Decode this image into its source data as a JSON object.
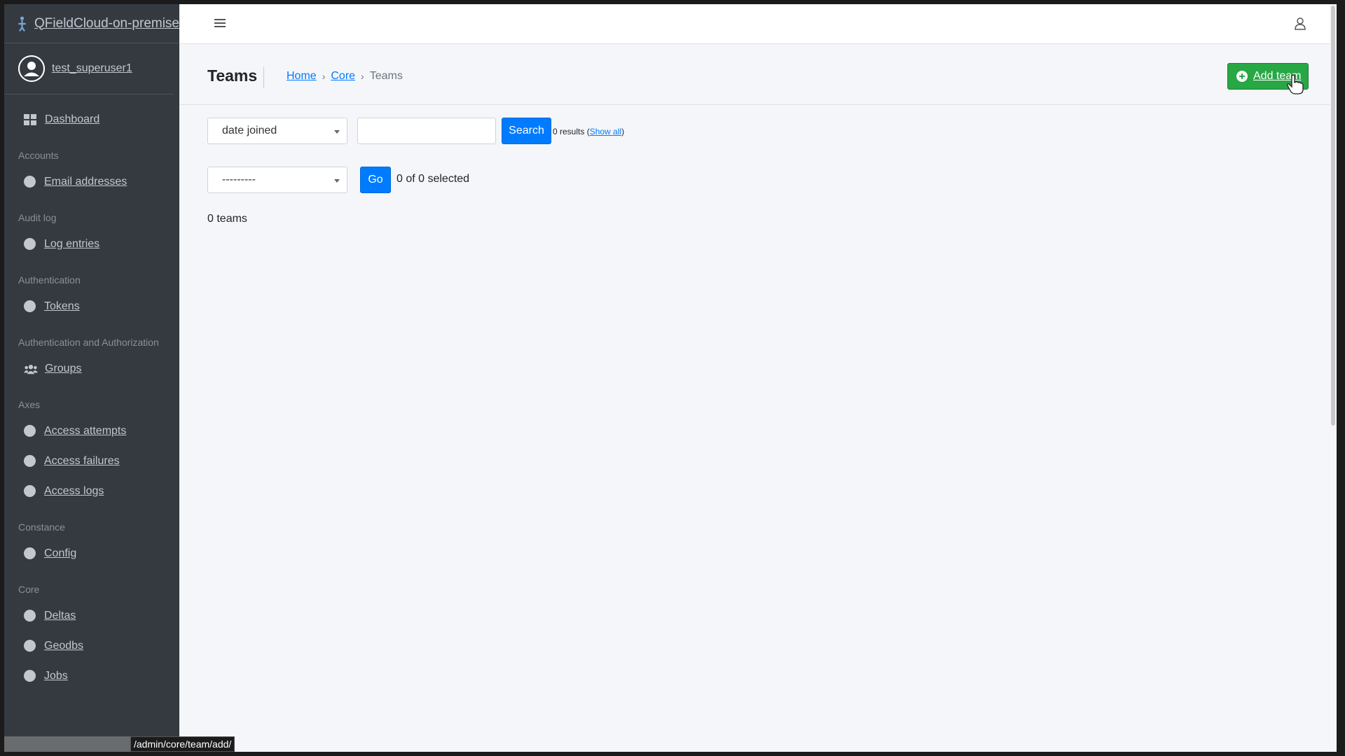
{
  "brand": {
    "title": "QFieldCloud-on-premise"
  },
  "user": {
    "name": "test_superuser1"
  },
  "sidebar": {
    "dashboard": "Dashboard",
    "sections": [
      {
        "header": "Accounts",
        "items": [
          "Email addresses"
        ]
      },
      {
        "header": "Audit log",
        "items": [
          "Log entries"
        ]
      },
      {
        "header": "Authentication",
        "items": [
          "Tokens"
        ]
      },
      {
        "header": "Authentication and Authorization",
        "items": [
          "Groups"
        ]
      },
      {
        "header": "Axes",
        "items": [
          "Access attempts",
          "Access failures",
          "Access logs"
        ]
      },
      {
        "header": "Constance",
        "items": [
          "Config"
        ]
      },
      {
        "header": "Core",
        "items": [
          "Deltas",
          "Geodbs",
          "Jobs"
        ]
      }
    ]
  },
  "header": {
    "title": "Teams",
    "breadcrumb": {
      "home": "Home",
      "core": "Core",
      "current": "Teams"
    },
    "add_label": "Add team"
  },
  "filter": {
    "sort_value": "date joined",
    "search_label": "Search",
    "results": "0 results",
    "show_all": "Show all"
  },
  "actions": {
    "action_value": "---------",
    "go_label": "Go",
    "selected": "0 of 0 selected"
  },
  "count": "0 teams",
  "status_url": "/admin/core/team/add/",
  "colors": {
    "sidebar": "#343a40",
    "primary": "#007bff",
    "success": "#28a745"
  }
}
